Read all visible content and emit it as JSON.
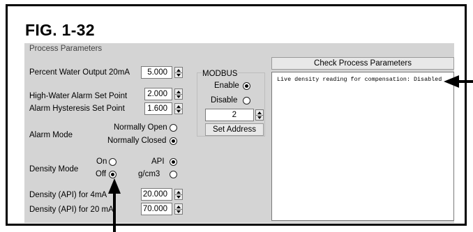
{
  "figure_label": "FIG. 1-32",
  "group_title": "Process Parameters",
  "fields": {
    "percent_water_label": "Percent Water Output 20mA",
    "percent_water_value": "5.000",
    "high_water_label": "High-Water Alarm Set Point",
    "high_water_value": "2.000",
    "hysteresis_label": "Alarm Hysteresis Set Point",
    "hysteresis_value": "1.600",
    "density_4ma_label": "Density (API) for 4mA",
    "density_4ma_value": "20.000",
    "density_20ma_label": "Density (API) for 20 mA",
    "density_20ma_value": "70.000"
  },
  "alarm_mode": {
    "label": "Alarm Mode",
    "option_open": "Normally Open",
    "option_closed": "Normally Closed",
    "selected": "Normally Closed"
  },
  "density_mode": {
    "label": "Density Mode",
    "option_on": "On",
    "option_off": "Off",
    "selected_state": "Off",
    "option_api": "API",
    "option_gcm3": "g/cm3",
    "selected_unit": "API"
  },
  "modbus": {
    "title": "MODBUS",
    "enable_label": "Enable",
    "disable_label": "Disable",
    "selected": "Enable",
    "address_value": "2",
    "set_address_label": "Set Address"
  },
  "check_button_label": "Check Process Parameters",
  "log_lines": [
    "Live density reading for compensation: Disabled"
  ]
}
